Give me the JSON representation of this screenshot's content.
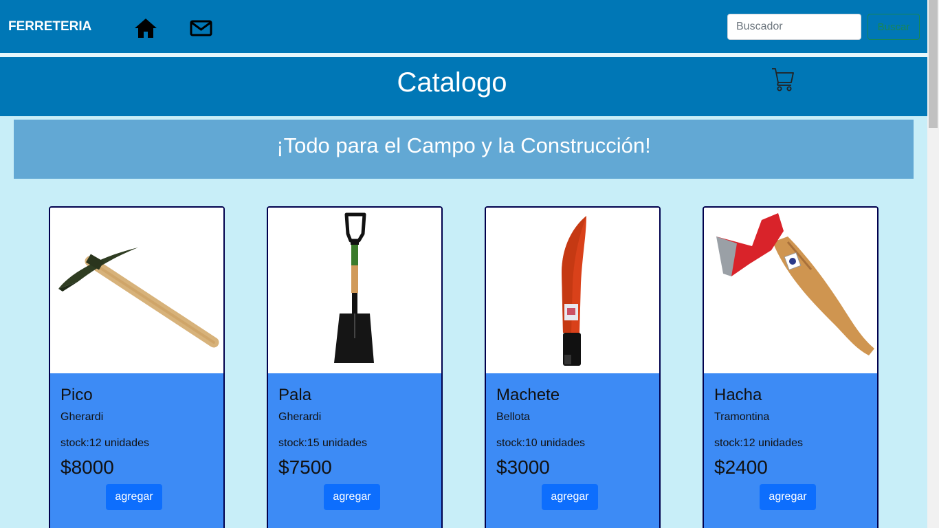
{
  "navbar": {
    "brand": "FERRETERIA",
    "icons": [
      "home-icon",
      "mail-icon"
    ],
    "search_placeholder": "Buscador",
    "search_button": "Buscar"
  },
  "header": {
    "title": "Catalogo",
    "cart_icon": "cart-icon"
  },
  "banner": {
    "text": "¡Todo para el Campo y la Construcción!"
  },
  "colors": {
    "navbar": "#0077b6",
    "banner": "#62a8d4",
    "page_bg": "#c8eef8",
    "card_body": "#3d8bf5",
    "button": "#0d6efd"
  },
  "products": [
    {
      "name": "Pico",
      "brand": "Gherardi",
      "stock": "stock:12 unidades",
      "price": "$8000",
      "button": "agregar"
    },
    {
      "name": "Pala",
      "brand": "Gherardi",
      "stock": "stock:15 unidades",
      "price": "$7500",
      "button": "agregar"
    },
    {
      "name": "Machete",
      "brand": "Bellota",
      "stock": "stock:10 unidades",
      "price": "$3000",
      "button": "agregar"
    },
    {
      "name": "Hacha",
      "brand": "Tramontina",
      "stock": "stock:12 unidades",
      "price": "$2400",
      "button": "agregar"
    }
  ]
}
